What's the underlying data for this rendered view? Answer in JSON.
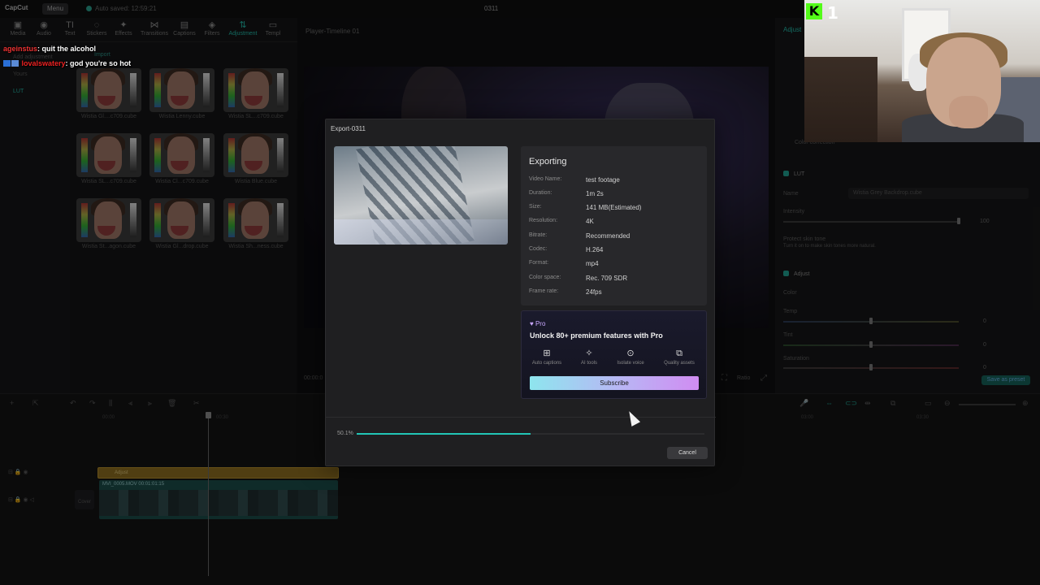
{
  "app": {
    "logo": "CapCut",
    "menu_label": "Menu",
    "autosave": "Auto saved: 12:59:21",
    "project_title": "0311"
  },
  "toolbar": {
    "tools": [
      {
        "label": "Media",
        "icon": "media-icon",
        "glyph": "▣"
      },
      {
        "label": "Audio",
        "icon": "audio-icon",
        "glyph": "◉"
      },
      {
        "label": "Text",
        "icon": "text-icon",
        "glyph": "TI"
      },
      {
        "label": "Stickers",
        "icon": "stickers-icon",
        "glyph": "◌"
      },
      {
        "label": "Effects",
        "icon": "effects-icon",
        "glyph": "✦"
      },
      {
        "label": "Transitions",
        "icon": "transitions-icon",
        "glyph": "⋈"
      },
      {
        "label": "Captions",
        "icon": "captions-icon",
        "glyph": "▤"
      },
      {
        "label": "Filters",
        "icon": "filters-icon",
        "glyph": "◈"
      },
      {
        "label": "Adjustment",
        "icon": "adjustment-icon",
        "glyph": "⇅"
      },
      {
        "label": "Templ",
        "icon": "templates-icon",
        "glyph": "▭"
      }
    ]
  },
  "left_nav": {
    "items": [
      "Add adjustment",
      "Yours",
      "LUT"
    ],
    "import_label": "Import"
  },
  "luts": [
    "Wistia Gl....c709.cube",
    "Wistia Lenny.cube",
    "Wistia SL...c709.cube",
    "Wistia SL...c709.cube",
    "Wistia Cl...c709.cube",
    "Wistia Blue.cube",
    "Wistia St...agon.cube",
    "Wistia Gl...drop.cube",
    "Wistia Sh...ness.cube"
  ],
  "player": {
    "title": "Player-Timeline 01",
    "time": "00:00:0",
    "ratio_label": "Ratio"
  },
  "right_panel": {
    "tab": "Adjust",
    "color_correction": "Color correction",
    "lut_header": "LUT",
    "name_label": "Name",
    "lut_name": "Wistia Grey Backdrop.cube",
    "intensity_label": "Intensity",
    "intensity_value": "100",
    "protect_label": "Protect skin tone",
    "protect_desc": "Turn it on to make skin tones more natural.",
    "adjust_header": "Adjust",
    "color_label": "Color",
    "temp_label": "Temp",
    "temp_value": "0",
    "tint_label": "Tint",
    "tint_value": "0",
    "saturation_label": "Saturation",
    "saturation_value": "0",
    "save_preset": "Save as preset"
  },
  "timeline": {
    "ruler": [
      "00:00",
      "00:30",
      "03:00",
      "03:30"
    ],
    "adjustment_clip": "Adjust",
    "video_clip": "MVI_0005.MOV  00:01:01:15",
    "cover_label": "Cover"
  },
  "dialog": {
    "title": "Export-0311",
    "status_title": "Exporting",
    "info": [
      {
        "label": "Video Name:",
        "value": "test footage"
      },
      {
        "label": "Duration:",
        "value": "1m 2s"
      },
      {
        "label": "Size:",
        "value": "141 MB(Estimated)"
      },
      {
        "label": "Resolution:",
        "value": "4K"
      },
      {
        "label": "Bitrate:",
        "value": "Recommended"
      },
      {
        "label": "Codec:",
        "value": "H.264"
      },
      {
        "label": "Format:",
        "value": "mp4"
      },
      {
        "label": "Color space:",
        "value": "Rec. 709 SDR"
      },
      {
        "label": "Frame rate:",
        "value": "24fps"
      }
    ],
    "pro": {
      "tag": "♥ Pro",
      "headline": "Unlock 80+ premium features with Pro",
      "features": [
        {
          "label": "Auto captions",
          "icon": "auto-captions-icon",
          "glyph": "⊞"
        },
        {
          "label": "AI tools",
          "icon": "ai-tools-icon",
          "glyph": "✧"
        },
        {
          "label": "Isolate voice",
          "icon": "isolate-voice-icon",
          "glyph": "⊙"
        },
        {
          "label": "Quality assets",
          "icon": "quality-assets-icon",
          "glyph": "⧉"
        }
      ],
      "subscribe_label": "Subscribe"
    },
    "progress_text": "50.1%",
    "progress_fraction": 0.501,
    "cancel_label": "Cancel"
  },
  "chat": [
    {
      "user": "ageinstus",
      "message": ": quit the alcohol"
    },
    {
      "user": "lovalswatery",
      "message": ": god you're so hot"
    }
  ],
  "stream": {
    "platform_glyph": "K",
    "viewer_count": "1"
  },
  "colors": {
    "accent": "#21b6a5",
    "progress": "#22c6b6",
    "subscribe_gradient_start": "#8ee5ee",
    "subscribe_gradient_end": "#d08cf2"
  }
}
